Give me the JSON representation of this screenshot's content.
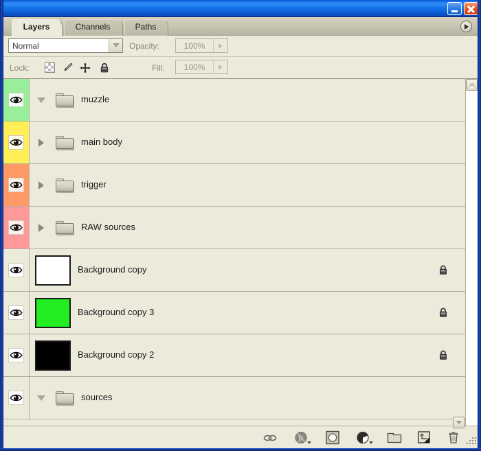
{
  "window": {
    "title": "",
    "minimize_label": "Minimize",
    "close_label": "Close"
  },
  "tabs": [
    {
      "id": "layers",
      "label": "Layers",
      "active": true
    },
    {
      "id": "channels",
      "label": "Channels",
      "active": false
    },
    {
      "id": "paths",
      "label": "Paths",
      "active": false
    }
  ],
  "panel_menu": {
    "icon": "panel-menu-icon",
    "label": "Panel Menu"
  },
  "options": {
    "blend_mode": {
      "label": "",
      "value": "Normal",
      "icon": "chevron-down-icon"
    },
    "opacity": {
      "label": "Opacity:",
      "value": "100%"
    },
    "fill": {
      "label": "Fill:",
      "value": "100%"
    }
  },
  "lock": {
    "label": "Lock:",
    "items": [
      {
        "name": "lock-transparent-pixels",
        "icon": "checkerboard-icon",
        "active": false
      },
      {
        "name": "lock-image-pixels",
        "icon": "paintbrush-icon",
        "active": false
      },
      {
        "name": "lock-position",
        "icon": "move-cross-icon",
        "active": false
      },
      {
        "name": "lock-all",
        "icon": "padlock-icon",
        "active": false
      }
    ]
  },
  "layers": [
    {
      "name": "muzzle",
      "type": "group",
      "visible": true,
      "expanded": true,
      "color_label": "#99ee99",
      "locked": false,
      "thumbnail": null
    },
    {
      "name": "main body",
      "type": "group",
      "visible": true,
      "expanded": false,
      "color_label": "#ffee55",
      "locked": false,
      "thumbnail": null
    },
    {
      "name": "trigger",
      "type": "group",
      "visible": true,
      "expanded": false,
      "color_label": "#ff9966",
      "locked": false,
      "thumbnail": null
    },
    {
      "name": "RAW sources",
      "type": "group",
      "visible": true,
      "expanded": false,
      "color_label": "#ff9999",
      "locked": false,
      "thumbnail": null
    },
    {
      "name": "Background copy",
      "type": "layer",
      "visible": true,
      "expanded": null,
      "color_label": null,
      "locked": true,
      "thumbnail": "#ffffff"
    },
    {
      "name": "Background copy 3",
      "type": "layer",
      "visible": true,
      "expanded": null,
      "color_label": null,
      "locked": true,
      "thumbnail": "#22ee22"
    },
    {
      "name": "Background copy 2",
      "type": "layer",
      "visible": true,
      "expanded": null,
      "color_label": null,
      "locked": true,
      "thumbnail": "#000000"
    },
    {
      "name": "sources",
      "type": "group",
      "visible": true,
      "expanded": true,
      "color_label": null,
      "locked": false,
      "thumbnail": null
    }
  ],
  "bottom_toolbar": [
    {
      "name": "link-layers-button",
      "icon": "chain-link-icon",
      "has_caret": false
    },
    {
      "name": "layer-style-button",
      "icon": "fx-icon",
      "has_caret": true
    },
    {
      "name": "add-layer-mask-button",
      "icon": "layer-mask-icon",
      "has_caret": false
    },
    {
      "name": "new-adjustment-layer-button",
      "icon": "half-filled-circle-icon",
      "has_caret": true
    },
    {
      "name": "new-group-button",
      "icon": "folder-icon",
      "has_caret": false
    },
    {
      "name": "new-layer-button",
      "icon": "new-layer-icon",
      "has_caret": false
    },
    {
      "name": "delete-layer-button",
      "icon": "trash-icon",
      "has_caret": false
    }
  ],
  "scrollbar": {
    "up_icon": "chevron-up-icon",
    "down_icon": "chevron-down-icon"
  },
  "resize_grip": {
    "icon": "resize-grip-icon"
  }
}
